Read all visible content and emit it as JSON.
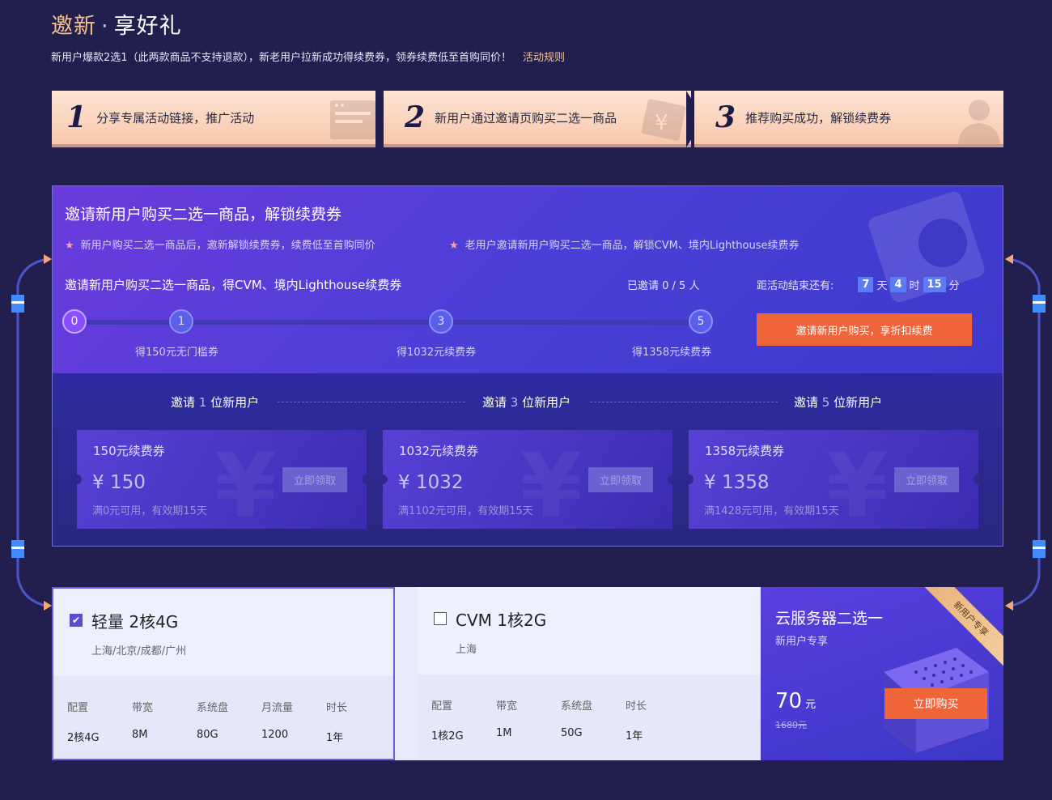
{
  "header": {
    "title_highlight": "邀新",
    "title_dot": "·",
    "title_rest": "享好礼",
    "subtitle": "新用户爆款2选1（此两款商品不支持退款），新老用户拉新成功得续费券，领券续费低至首购同价！",
    "rules_link": "活动规则"
  },
  "steps": [
    {
      "num": "1",
      "text": "分享专属活动链接，推广活动"
    },
    {
      "num": "2",
      "text": "新用户通过邀请页购买二选一商品"
    },
    {
      "num": "3",
      "text": "推荐购买成功，解锁续费券"
    }
  ],
  "invite": {
    "heading": "邀请新用户购买二选一商品，解锁续费券",
    "bullets": [
      "新用户购买二选一商品后，邀新解锁续费券，续费低至首购同价",
      "老用户邀请新用户购买二选一商品，解锁CVM、境内Lighthouse续费券"
    ],
    "goal": "邀请新用户购买二选一商品，得CVM、境内Lighthouse续费券",
    "invited_text": "已邀请 0 / 5 人",
    "countdown_label": "距活动结束还有:",
    "countdown": {
      "days": "7",
      "days_unit": "天",
      "hours": "4",
      "hours_unit": "时",
      "minutes": "15",
      "minutes_unit": "分"
    },
    "cta": "邀请新用户购买，享折扣续费",
    "nodes": [
      "0",
      "1",
      "3",
      "5"
    ],
    "invited_count": 0,
    "milestones": [
      "得150元无门槛券",
      "得1032元续费券",
      "得1358元续费券"
    ],
    "tiers": [
      {
        "pre": "邀请",
        "n": "1",
        "post": "位新用户"
      },
      {
        "pre": "邀请",
        "n": "3",
        "post": "位新用户"
      },
      {
        "pre": "邀请",
        "n": "5",
        "post": "位新用户"
      }
    ],
    "coupons": [
      {
        "name": "150元续费券",
        "amount": "¥ 150",
        "cond": "满0元可用，有效期15天",
        "claim": "立即领取"
      },
      {
        "name": "1032元续费券",
        "amount": "¥ 1032",
        "cond": "满1102元可用，有效期15天",
        "claim": "立即领取"
      },
      {
        "name": "1358元续费券",
        "amount": "¥ 1358",
        "cond": "满1428元可用，有效期15天",
        "claim": "立即领取"
      }
    ],
    "yen_glyph": "¥"
  },
  "products": [
    {
      "name": "轻量 2核4G",
      "regions": "上海/北京/成都/广州",
      "checked": true,
      "specs_head": [
        "配置",
        "带宽",
        "系统盘",
        "月流量",
        "时长"
      ],
      "specs_val": [
        "2核4G",
        "8M",
        "80G",
        "1200",
        "1年"
      ]
    },
    {
      "name": "CVM 1核2G",
      "regions": "上海",
      "checked": false,
      "specs_head": [
        "配置",
        "带宽",
        "系统盘",
        "时长"
      ],
      "specs_val": [
        "1核2G",
        "1M",
        "50G",
        "1年"
      ]
    }
  ],
  "promo": {
    "title": "云服务器二选一",
    "sub": "新用户专享",
    "price": "70",
    "unit": "元",
    "old_price": "1680元",
    "buy": "立即购买",
    "ribbon": "新用户专享"
  },
  "colors": {
    "accent": "#f0643a",
    "gold": "#f6c28e",
    "background": "#221f4f",
    "panel": "#4a3fd6"
  }
}
